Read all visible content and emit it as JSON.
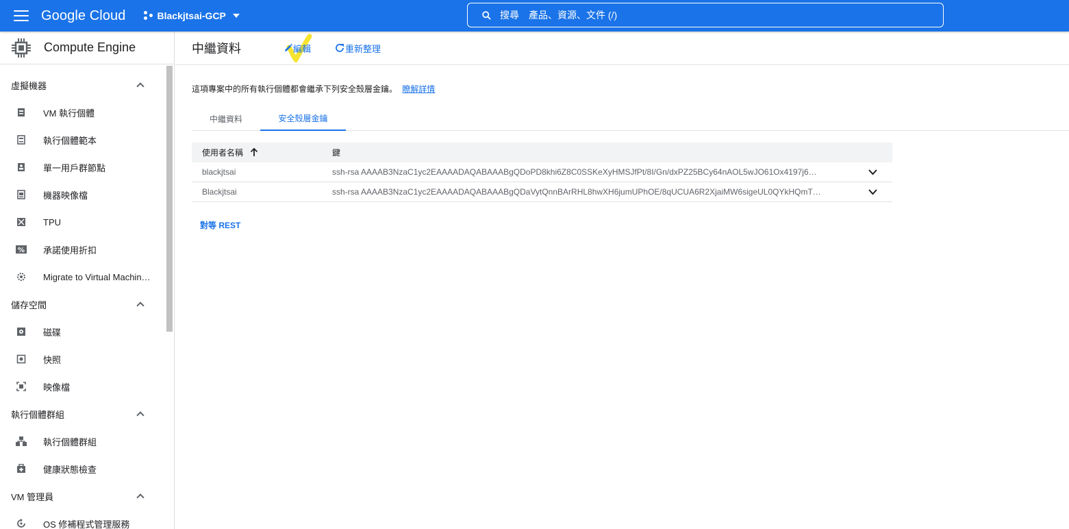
{
  "topbar": {
    "brand": "Google Cloud",
    "project": "Blackjtsai-GCP",
    "search_label": "搜尋",
    "search_placeholder": "產品、資源、文件 (/)",
    "bg_color": "#1a73e8"
  },
  "sidebar": {
    "title": "Compute Engine",
    "sections": [
      {
        "label": "虛擬機器",
        "items": [
          {
            "label": "VM 執行個體",
            "icon": "vm-icon"
          },
          {
            "label": "執行個體範本",
            "icon": "template-icon"
          },
          {
            "label": "單一用戶群節點",
            "icon": "sole-tenant-icon"
          },
          {
            "label": "機器映像檔",
            "icon": "machine-image-icon"
          },
          {
            "label": "TPU",
            "icon": "tpu-icon"
          },
          {
            "label": "承諾使用折扣",
            "icon": "percent-icon"
          },
          {
            "label": "Migrate to Virtual Machin…",
            "icon": "migrate-icon"
          }
        ]
      },
      {
        "label": "儲存空間",
        "items": [
          {
            "label": "磁碟",
            "icon": "disk-icon"
          },
          {
            "label": "快照",
            "icon": "snapshot-icon"
          },
          {
            "label": "映像檔",
            "icon": "image-icon"
          }
        ]
      },
      {
        "label": "執行個體群組",
        "items": [
          {
            "label": "執行個體群組",
            "icon": "instance-group-icon"
          },
          {
            "label": "健康狀態檢查",
            "icon": "health-check-icon"
          }
        ]
      },
      {
        "label": "VM 管理員",
        "items": [
          {
            "label": "OS 修補程式管理服務",
            "icon": "os-patch-icon"
          }
        ]
      }
    ]
  },
  "main": {
    "title": "中繼資料",
    "edit_label": "編輯",
    "refresh_label": "重新整理",
    "description": "這項專案中的所有執行個體都會繼承下列安全殼層金鑰。",
    "learn_more": "瞭解詳情",
    "tabs": [
      {
        "label": "中繼資料",
        "active": false
      },
      {
        "label": "安全殼層金鑰",
        "active": true
      }
    ],
    "table": {
      "headers": {
        "username": "使用者名稱",
        "key": "鍵"
      },
      "rows": [
        {
          "username": "blackjtsai",
          "key": "ssh-rsa AAAAB3NzaC1yc2EAAAADAQABAAABgQDoPD8khi6Z8C0SSKeXyHMSJfPt/8I/Gn/dxPZ25BCy64nAOL5wJO61Ox4197j6…"
        },
        {
          "username": "Blackjtsai",
          "key": "ssh-rsa AAAAB3NzaC1yc2EAAAADAQABAAABgQDaVytQnnBArRHL8hwXH6jumUPhOE/8qUCUA6R2XjaiMW6sigeUL0QYkHQmT…"
        }
      ]
    },
    "rest_label": "對等 REST"
  }
}
